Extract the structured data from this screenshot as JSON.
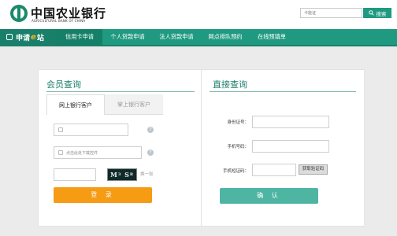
{
  "header": {
    "logo_cn": "中国农业银行",
    "logo_en": "AGRICULTURAL BANK OF CHINA",
    "search_placeholder": "卡能证",
    "search_button": "搜索"
  },
  "nav": {
    "brand_prefix": "申请",
    "brand_e": "e",
    "brand_suffix": "站",
    "items": [
      {
        "label": "信用卡申请",
        "active": true
      },
      {
        "label": "个人贷款申请",
        "active": false
      },
      {
        "label": "法人贷款申请",
        "active": false
      },
      {
        "label": "网点排队预约",
        "active": false
      },
      {
        "label": "在线预填单",
        "active": false
      }
    ]
  },
  "member_query": {
    "title": "会员查询",
    "tabs": [
      {
        "label": "网上银行客户",
        "active": true
      },
      {
        "label": "掌上银行客户",
        "active": false
      }
    ],
    "plugin_placeholder": "点击此处下载控件",
    "captcha_text": "M3SR",
    "refresh_label": "换一张",
    "help_glyph": "?",
    "login_button": "登  录"
  },
  "direct_query": {
    "title": "直接查询",
    "id_label": "身份证号：",
    "phone_label": "手机号码：",
    "sms_label": "手机短证码：",
    "get_code_button": "获取验证码",
    "confirm_button": "确  认"
  },
  "colors": {
    "brand": "#1f9a80",
    "brand_dark": "#1a7f6a",
    "login": "#f59b14",
    "confirm": "#4fb5a3"
  }
}
